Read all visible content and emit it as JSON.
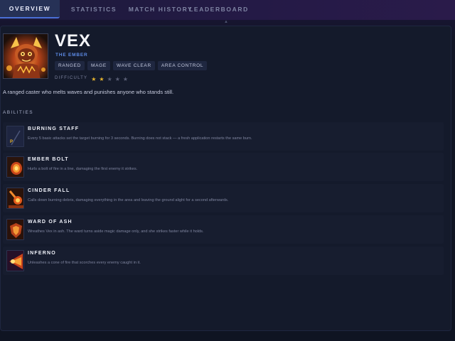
{
  "nav": {
    "tabs": [
      {
        "label": "OVERVIEW",
        "active": true
      },
      {
        "label": "STATISTICS",
        "active": false
      },
      {
        "label": "MATCH HISTORY",
        "active": false
      },
      {
        "label": "LEADERBOARD",
        "active": false
      }
    ]
  },
  "champion": {
    "name": "VEX",
    "title": "THE EMBER",
    "tags": [
      "RANGED",
      "MAGE",
      "WAVE CLEAR",
      "AREA CONTROL"
    ],
    "difficulty_label": "DIFFICULTY",
    "difficulty_rating": 2,
    "difficulty_max": 5,
    "description": "A ranged caster who melts waves and punishes anyone who stands still."
  },
  "abilities_heading": "ABILITIES",
  "abilities": [
    {
      "name": "BURNING STAFF",
      "key": "P",
      "icon": "staff-icon",
      "description": "Every 5 basic attacks set the target burning for 3 seconds. Burning does not stack — a fresh application restarts the same burn."
    },
    {
      "name": "EMBER BOLT",
      "key": "",
      "icon": "fire-bolt-icon",
      "description": "Hurls a bolt of fire in a line, damaging the first enemy it strikes."
    },
    {
      "name": "CINDER FALL",
      "key": "",
      "icon": "meteor-icon",
      "description": "Calls down burning debris, damaging everything in the area and leaving the ground alight for a second afterwards."
    },
    {
      "name": "WARD OF ASH",
      "key": "",
      "icon": "shield-icon",
      "description": "Wreathes Vex in ash. The ward turns aside magic damage only, and she strikes faster while it holds."
    },
    {
      "name": "INFERNO",
      "key": "",
      "icon": "flame-cone-icon",
      "description": "Unleashes a cone of fire that scorches every enemy caught in it."
    }
  ],
  "colors": {
    "accent": "#4a6fd6",
    "title_blue": "#5d8be6",
    "star_gold": "#e7b52e",
    "background": "#141a2b"
  }
}
